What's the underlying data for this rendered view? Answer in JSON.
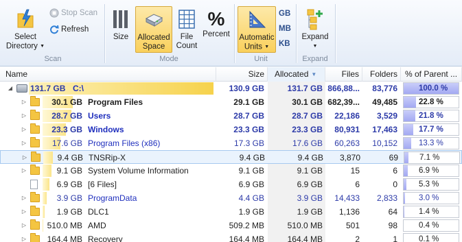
{
  "ribbon": {
    "scan": {
      "select_directory": "Select\nDirectory",
      "select_directory_l1": "Select",
      "select_directory_l2": "Directory",
      "stop_scan": "Stop Scan",
      "refresh": "Refresh",
      "group_label": "Scan"
    },
    "mode": {
      "size": "Size",
      "allocated_l1": "Allocated",
      "allocated_l2": "Space",
      "file_count_l1": "File",
      "file_count_l2": "Count",
      "percent": "Percent",
      "percent_glyph": "%",
      "group_label": "Mode",
      "active": "Allocated Space"
    },
    "unit": {
      "automatic_l1": "Automatic",
      "automatic_l2": "Units",
      "gb": "GB",
      "mb": "MB",
      "kb": "KB",
      "group_label": "Unit"
    },
    "expand": {
      "expand": "Expand",
      "group_label": "Expand"
    }
  },
  "columns": {
    "name": "Name",
    "size": "Size",
    "allocated": "Allocated",
    "files": "Files",
    "folders": "Folders",
    "percent": "% of Parent ..."
  },
  "rows": [
    {
      "bar_label": "131.7 GB",
      "name": "C:\\",
      "size": "130.9 GB",
      "allocated": "131.7 GB",
      "files": "866,88...",
      "folders": "83,776",
      "percent_text": "100.0 %",
      "percent": 100.0,
      "type": "drive",
      "bold": true,
      "blue": true,
      "level": 0
    },
    {
      "bar_label": "30.1 GB",
      "name": "Program Files",
      "size": "29.1 GB",
      "allocated": "30.1 GB",
      "files": "682,39...",
      "folders": "49,485",
      "percent_text": "22.8 %",
      "percent": 22.8,
      "type": "folder",
      "bold": true,
      "blue": false,
      "level": 1
    },
    {
      "bar_label": "28.7 GB",
      "name": "Users",
      "size": "28.7 GB",
      "allocated": "28.7 GB",
      "files": "22,186",
      "folders": "3,529",
      "percent_text": "21.8 %",
      "percent": 21.8,
      "type": "folder",
      "bold": true,
      "blue": true,
      "level": 1
    },
    {
      "bar_label": "23.3 GB",
      "name": "Windows",
      "size": "23.3 GB",
      "allocated": "23.3 GB",
      "files": "80,931",
      "folders": "17,463",
      "percent_text": "17.7 %",
      "percent": 17.7,
      "type": "folder",
      "bold": true,
      "blue": true,
      "level": 1
    },
    {
      "bar_label": "17.6 GB",
      "name": "Program Files (x86)",
      "size": "17.3 GB",
      "allocated": "17.6 GB",
      "files": "60,263",
      "folders": "10,152",
      "percent_text": "13.3 %",
      "percent": 13.3,
      "type": "folder",
      "bold": false,
      "blue": true,
      "level": 1
    },
    {
      "bar_label": "9.4 GB",
      "name": "TNSRip-X",
      "size": "9.4 GB",
      "allocated": "9.4 GB",
      "files": "3,870",
      "folders": "69",
      "percent_text": "7.1 %",
      "percent": 7.1,
      "type": "folder",
      "bold": false,
      "blue": false,
      "level": 1,
      "selected": true
    },
    {
      "bar_label": "9.1 GB",
      "name": "System Volume Information",
      "size": "9.1 GB",
      "allocated": "9.1 GB",
      "files": "15",
      "folders": "6",
      "percent_text": "6.9 %",
      "percent": 6.9,
      "type": "folder",
      "bold": false,
      "blue": false,
      "level": 1
    },
    {
      "bar_label": "6.9 GB",
      "name": "[6 Files]",
      "size": "6.9 GB",
      "allocated": "6.9 GB",
      "files": "6",
      "folders": "0",
      "percent_text": "5.3 %",
      "percent": 5.3,
      "type": "file",
      "bold": false,
      "blue": false,
      "level": 1
    },
    {
      "bar_label": "3.9 GB",
      "name": "ProgramData",
      "size": "4.4 GB",
      "allocated": "3.9 GB",
      "files": "14,433",
      "folders": "2,833",
      "percent_text": "3.0 %",
      "percent": 3.0,
      "type": "folder",
      "bold": false,
      "blue": true,
      "level": 1
    },
    {
      "bar_label": "1.9 GB",
      "name": "DLC1",
      "size": "1.9 GB",
      "allocated": "1.9 GB",
      "files": "1,136",
      "folders": "64",
      "percent_text": "1.4 %",
      "percent": 1.4,
      "type": "folder",
      "bold": false,
      "blue": false,
      "level": 1
    },
    {
      "bar_label": "510.0 MB",
      "name": "AMD",
      "size": "509.2 MB",
      "allocated": "510.0 MB",
      "files": "501",
      "folders": "98",
      "percent_text": "0.4 %",
      "percent": 0.4,
      "type": "folder",
      "bold": false,
      "blue": false,
      "level": 1
    },
    {
      "bar_label": "164.4 MB",
      "name": "Recovery",
      "size": "164.4 MB",
      "allocated": "164.4 MB",
      "files": "2",
      "folders": "1",
      "percent_text": "0.1 %",
      "percent": 0.1,
      "type": "folder",
      "bold": false,
      "blue": false,
      "level": 1
    }
  ],
  "colors": {
    "bar": "#fbe58a",
    "bar_strong": "#f6d24c",
    "percent_fill": "#a3a9f2",
    "blue_text": "#1f2fbd"
  },
  "icons": {
    "select_directory": "folder-lightning-icon",
    "stop_scan": "stop-icon",
    "refresh": "refresh-icon",
    "size": "bars-icon",
    "allocated": "disk-icon",
    "file_count": "grid-icon",
    "percent": "percent-icon",
    "automatic_units": "triangle-ruler-icon",
    "expand": "expand-tree-icon"
  }
}
